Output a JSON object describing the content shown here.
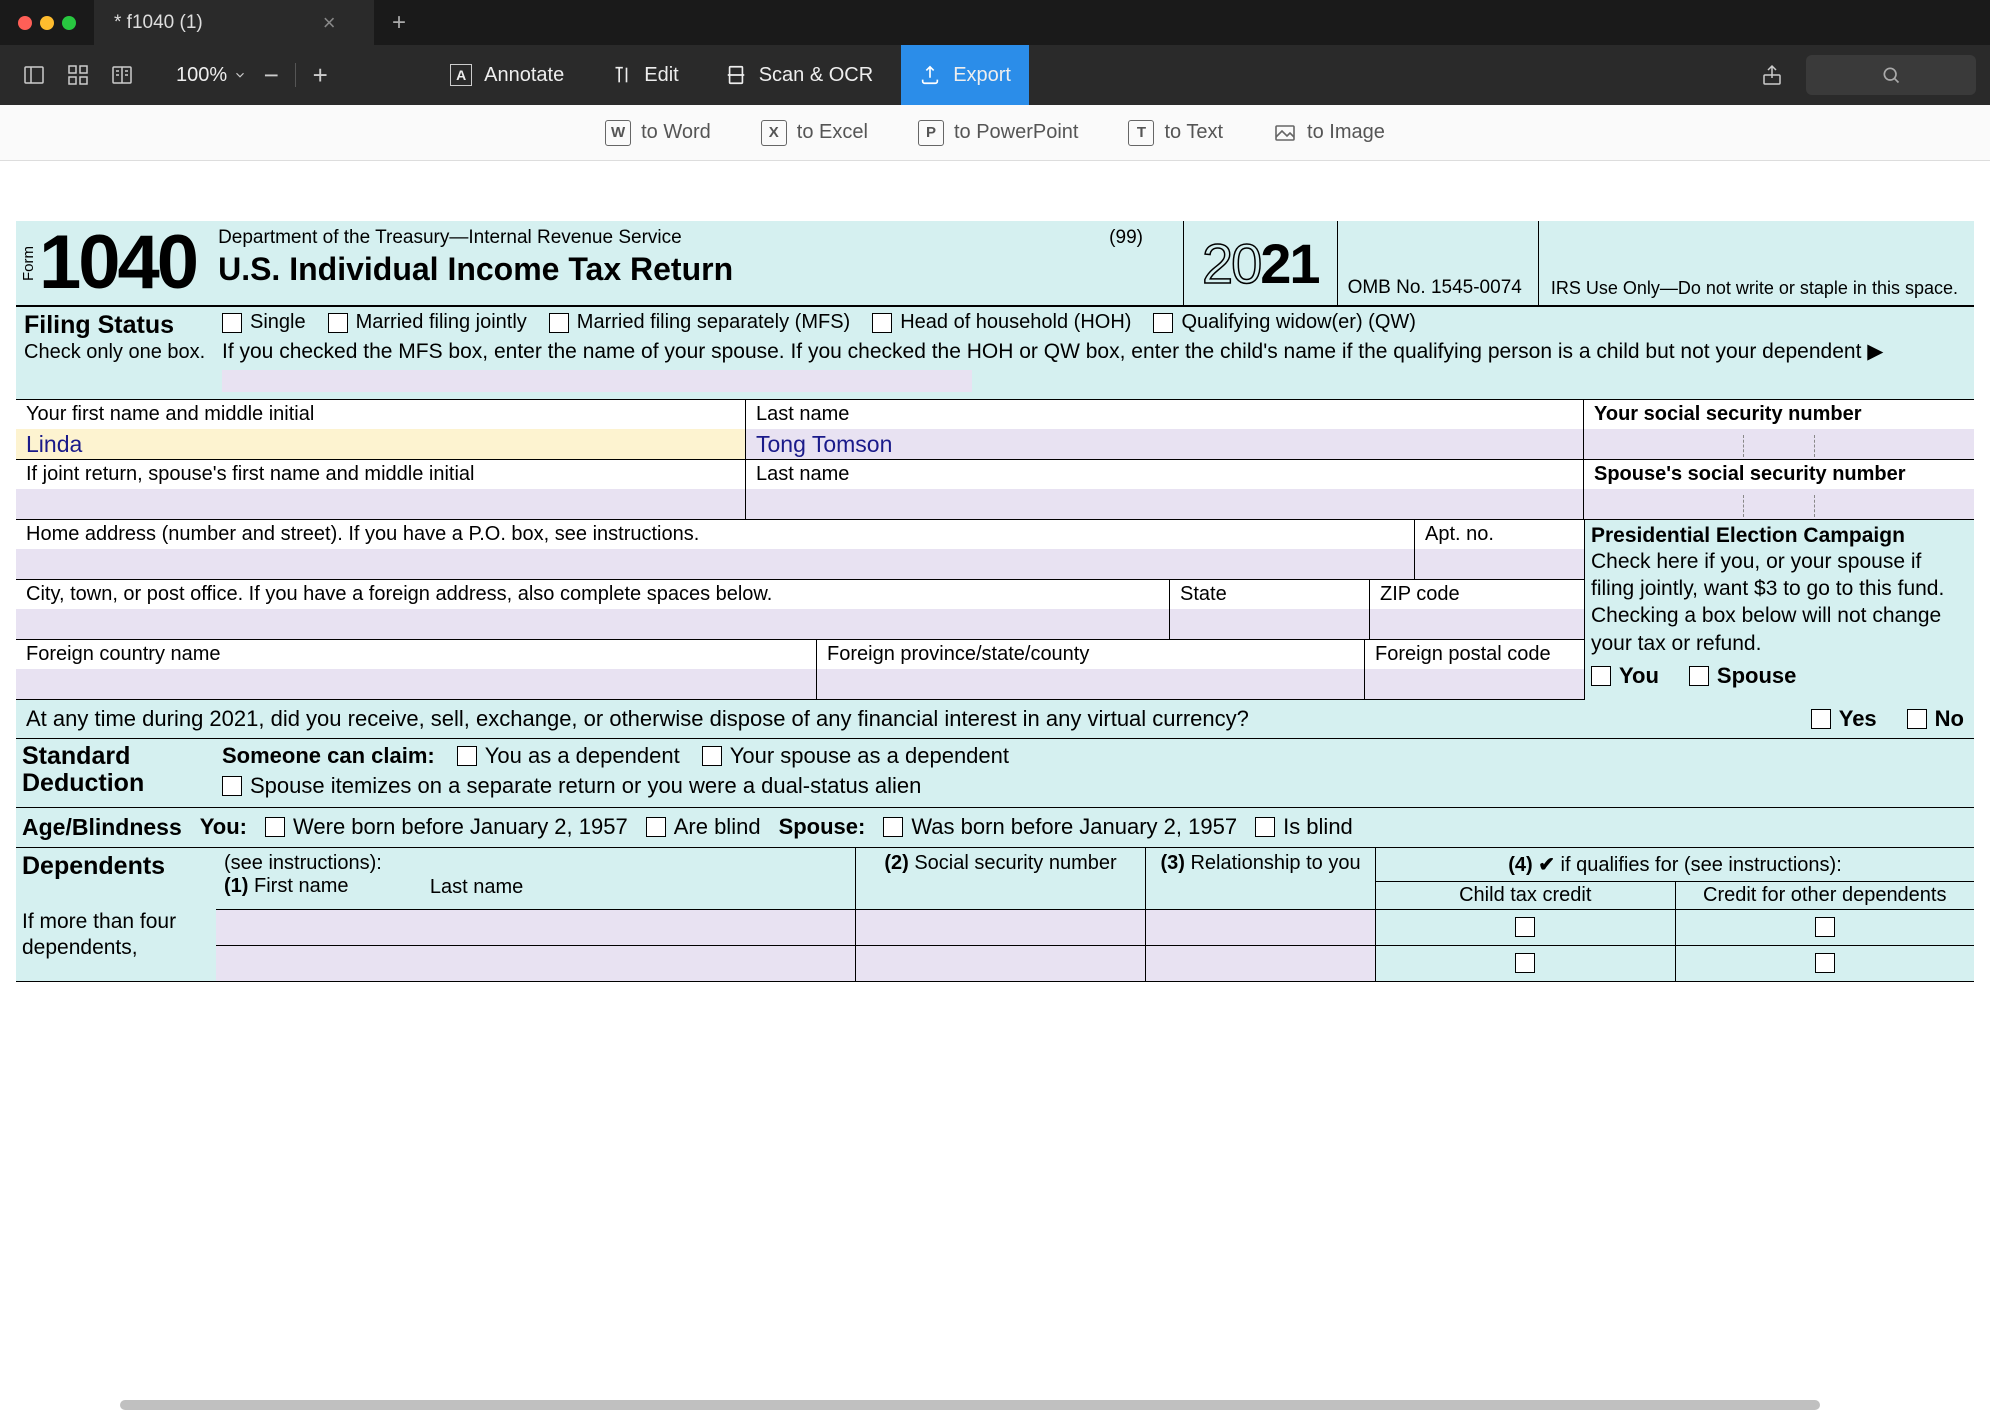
{
  "tab": {
    "title": "* f1040 (1)"
  },
  "zoom": "100%",
  "toolbar": {
    "annotate": "Annotate",
    "edit": "Edit",
    "scan": "Scan & OCR",
    "export": "Export"
  },
  "exportBar": {
    "word": "to Word",
    "excel": "to Excel",
    "ppt": "to PowerPoint",
    "text": "to Text",
    "image": "to Image"
  },
  "form": {
    "formLabel": "Form",
    "formNumber": "1040",
    "dept": "Department of the Treasury—Internal Revenue Service",
    "code99": "(99)",
    "title": "U.S. Individual Income Tax Return",
    "yearOutline": "20",
    "yearBold": "21",
    "omb": "OMB No. 1545-0074",
    "irsUse": "IRS Use Only—Do not write or staple in this space.",
    "filing": {
      "title": "Filing Status",
      "sub": "Check only one box.",
      "single": "Single",
      "mfj": "Married filing jointly",
      "mfs": "Married filing separately (MFS)",
      "hoh": "Head of household (HOH)",
      "qw": "Qualifying widow(er) (QW)",
      "instr": "If you checked the MFS box, enter the name of your spouse. If you checked the HOH or QW box, enter the child's name if the qualifying person is a child but not your dependent ▶"
    },
    "labels": {
      "firstName": "Your first name and middle initial",
      "lastName": "Last name",
      "ssn": "Your social security number",
      "spouseFirst": "If joint return, spouse's first name and middle initial",
      "spouseLast": "Last name",
      "spouseSsn": "Spouse's social security number",
      "homeAddr": "Home address (number and street). If you have a P.O. box, see instructions.",
      "apt": "Apt. no.",
      "city": "City, town, or post office. If you have a foreign address, also complete spaces below.",
      "state": "State",
      "zip": "ZIP code",
      "fCountry": "Foreign country name",
      "fProv": "Foreign province/state/county",
      "fPost": "Foreign postal code"
    },
    "values": {
      "firstName": "Linda",
      "lastName": "Tong Tomson"
    },
    "pres": {
      "title": "Presidential Election Campaign",
      "text": "Check here if you, or your spouse if filing jointly, want $3 to go to this fund. Checking a box below will not change your tax or refund.",
      "you": "You",
      "spouse": "Spouse"
    },
    "crypto": {
      "q": "At any time during 2021, did you receive, sell, exchange, or otherwise dispose of any financial interest in any virtual currency?",
      "yes": "Yes",
      "no": "No"
    },
    "std": {
      "title": "Standard Deduction",
      "someone": "Someone can claim:",
      "youDep": "You as a dependent",
      "spouseDep": "Your spouse as a dependent",
      "spouseItem": "Spouse itemizes on a separate return or you were a dual-status alien"
    },
    "age": {
      "title": "Age/Blindness",
      "you": "You:",
      "youBorn": "Were born before January 2, 1957",
      "youBlind": "Are blind",
      "spouse": "Spouse:",
      "spouseBorn": "Was born before January 2, 1957",
      "spouseBlind": "Is blind"
    },
    "dep": {
      "title": "Dependents",
      "see": "(see instructions):",
      "more": "If more than four dependents,",
      "c1": "(1)",
      "c1first": "First name",
      "c1last": "Last name",
      "c2": "(2)",
      "c2text": "Social security number",
      "c3": "(3)",
      "c3text": "Relationship to you",
      "c4": "(4) ✔",
      "c4text": "if qualifies for (see instructions):",
      "c4a": "Child tax credit",
      "c4b": "Credit for other dependents"
    }
  }
}
